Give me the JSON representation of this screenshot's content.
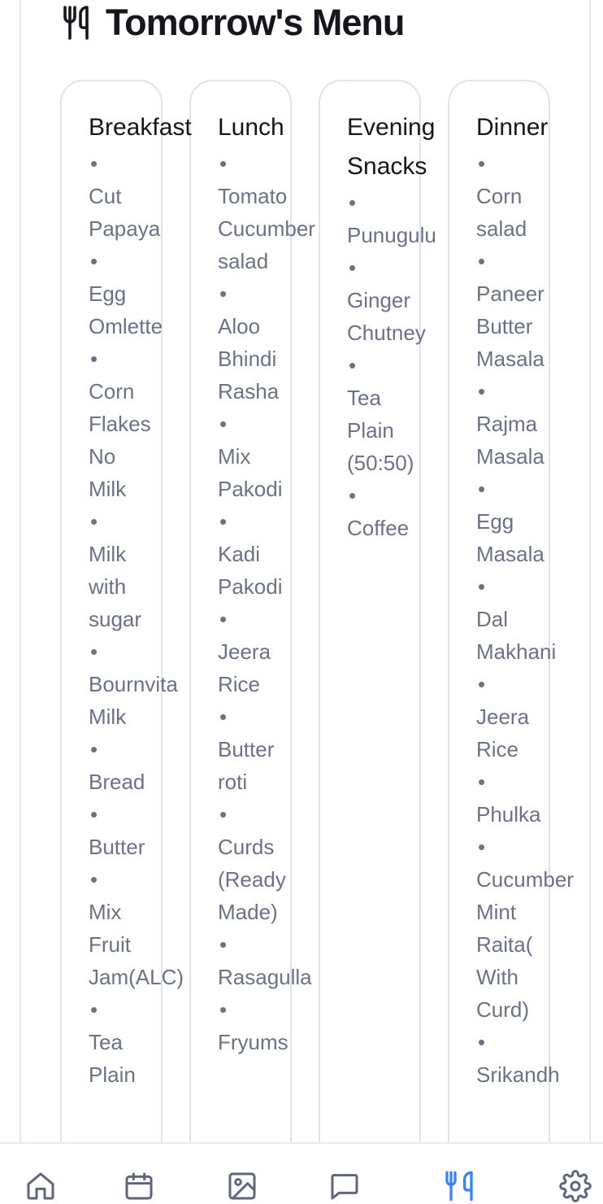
{
  "header": {
    "title": "Tomorrow's Menu",
    "icon": "utensils-icon"
  },
  "meals": [
    {
      "title": "Breakfast",
      "items": [
        "Cut\nPapaya",
        "Egg\nOmlette",
        "Corn\nFlakes\nNo\nMilk",
        "Milk\nwith\nsugar",
        "Bournvita\nMilk",
        "Bread",
        "Butter",
        "Mix\nFruit\nJam(ALC)",
        "Tea\nPlain"
      ]
    },
    {
      "title": "Lunch",
      "items": [
        "Tomato\nCucumber\nsalad",
        "Aloo\nBhindi\nRasha",
        "Mix\nPakodi",
        "Kadi\nPakodi",
        "Jeera\nRice",
        "Butter\nroti",
        "Curds\n(Ready\nMade)",
        "Rasagulla",
        "Fryums"
      ]
    },
    {
      "title": "Evening\nSnacks",
      "items": [
        "Punugulu",
        "Ginger\nChutney",
        "Tea\nPlain\n(50:50)",
        "Coffee"
      ]
    },
    {
      "title": "Dinner",
      "items": [
        "Corn\nsalad",
        "Paneer\nButter\nMasala",
        "Rajma\nMasala",
        "Egg\nMasala",
        "Dal\nMakhani",
        "Jeera\nRice",
        "Phulka",
        "Cucumber\nMint\nRaita(\nWith\nCurd)",
        "Srikandh"
      ]
    }
  ],
  "bottom_nav": [
    {
      "icon": "home-icon",
      "active": false
    },
    {
      "icon": "calendar-icon",
      "active": false
    },
    {
      "icon": "image-icon",
      "active": false
    },
    {
      "icon": "chat-icon",
      "active": false
    },
    {
      "icon": "utensils-icon",
      "active": true
    },
    {
      "icon": "gear-icon",
      "active": false
    }
  ],
  "colors": {
    "title": "#16161c",
    "item_text": "#6b7283",
    "border": "#dfe3eb",
    "nav_inactive": "#5f6678",
    "nav_active": "#3b82f6"
  }
}
